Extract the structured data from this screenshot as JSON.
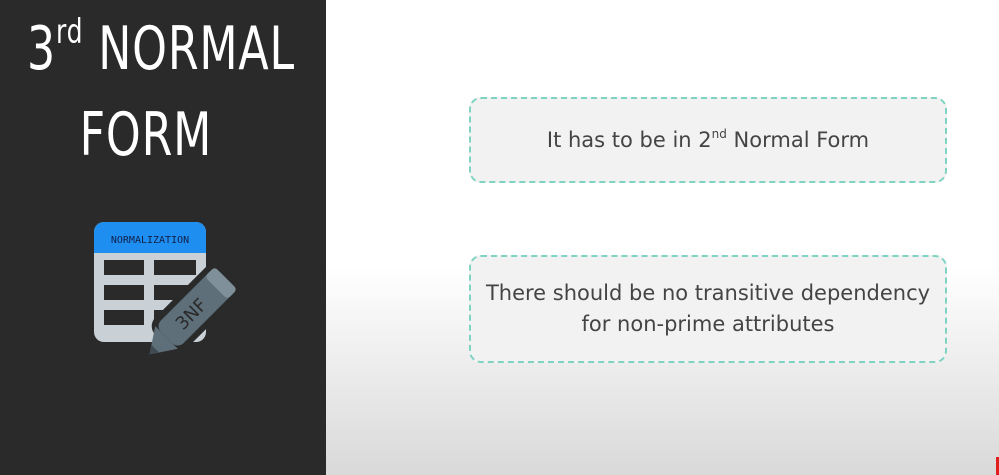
{
  "title": {
    "ordinal_number": "3",
    "ordinal_suffix": "rd",
    "line1_rest": " NORMAL",
    "line2": "FORM"
  },
  "icon": {
    "header_label": "NORMALIZATION",
    "pencil_label": "3NF",
    "colors": {
      "header": "#1f8ef1",
      "table": "#c9d1d6",
      "pencil": "#5e6f7a",
      "background": "#2a2a2a"
    }
  },
  "cards": [
    {
      "prefix": "It has to be in 2",
      "superscript": "nd",
      "suffix": " Normal Form"
    },
    {
      "line1": "There should be no transitive dependency",
      "line2": "for non-prime attributes"
    }
  ],
  "colors": {
    "card_border": "#7fd3c2",
    "card_text": "#444444",
    "title_text": "#ffffff"
  }
}
